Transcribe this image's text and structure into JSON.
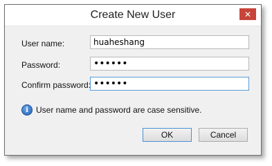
{
  "window": {
    "title": "Create New User",
    "close_glyph": "✕"
  },
  "form": {
    "username_label": "User name:",
    "username_value": "huaheshang",
    "password_label": "Password:",
    "password_value": "••••••",
    "confirm_label": "Confirm password:",
    "confirm_value": "••••••"
  },
  "info": {
    "icon": "info-icon",
    "glyph": "i",
    "text": "User name and password are case sensitive."
  },
  "buttons": {
    "ok": "OK",
    "cancel": "Cancel"
  }
}
